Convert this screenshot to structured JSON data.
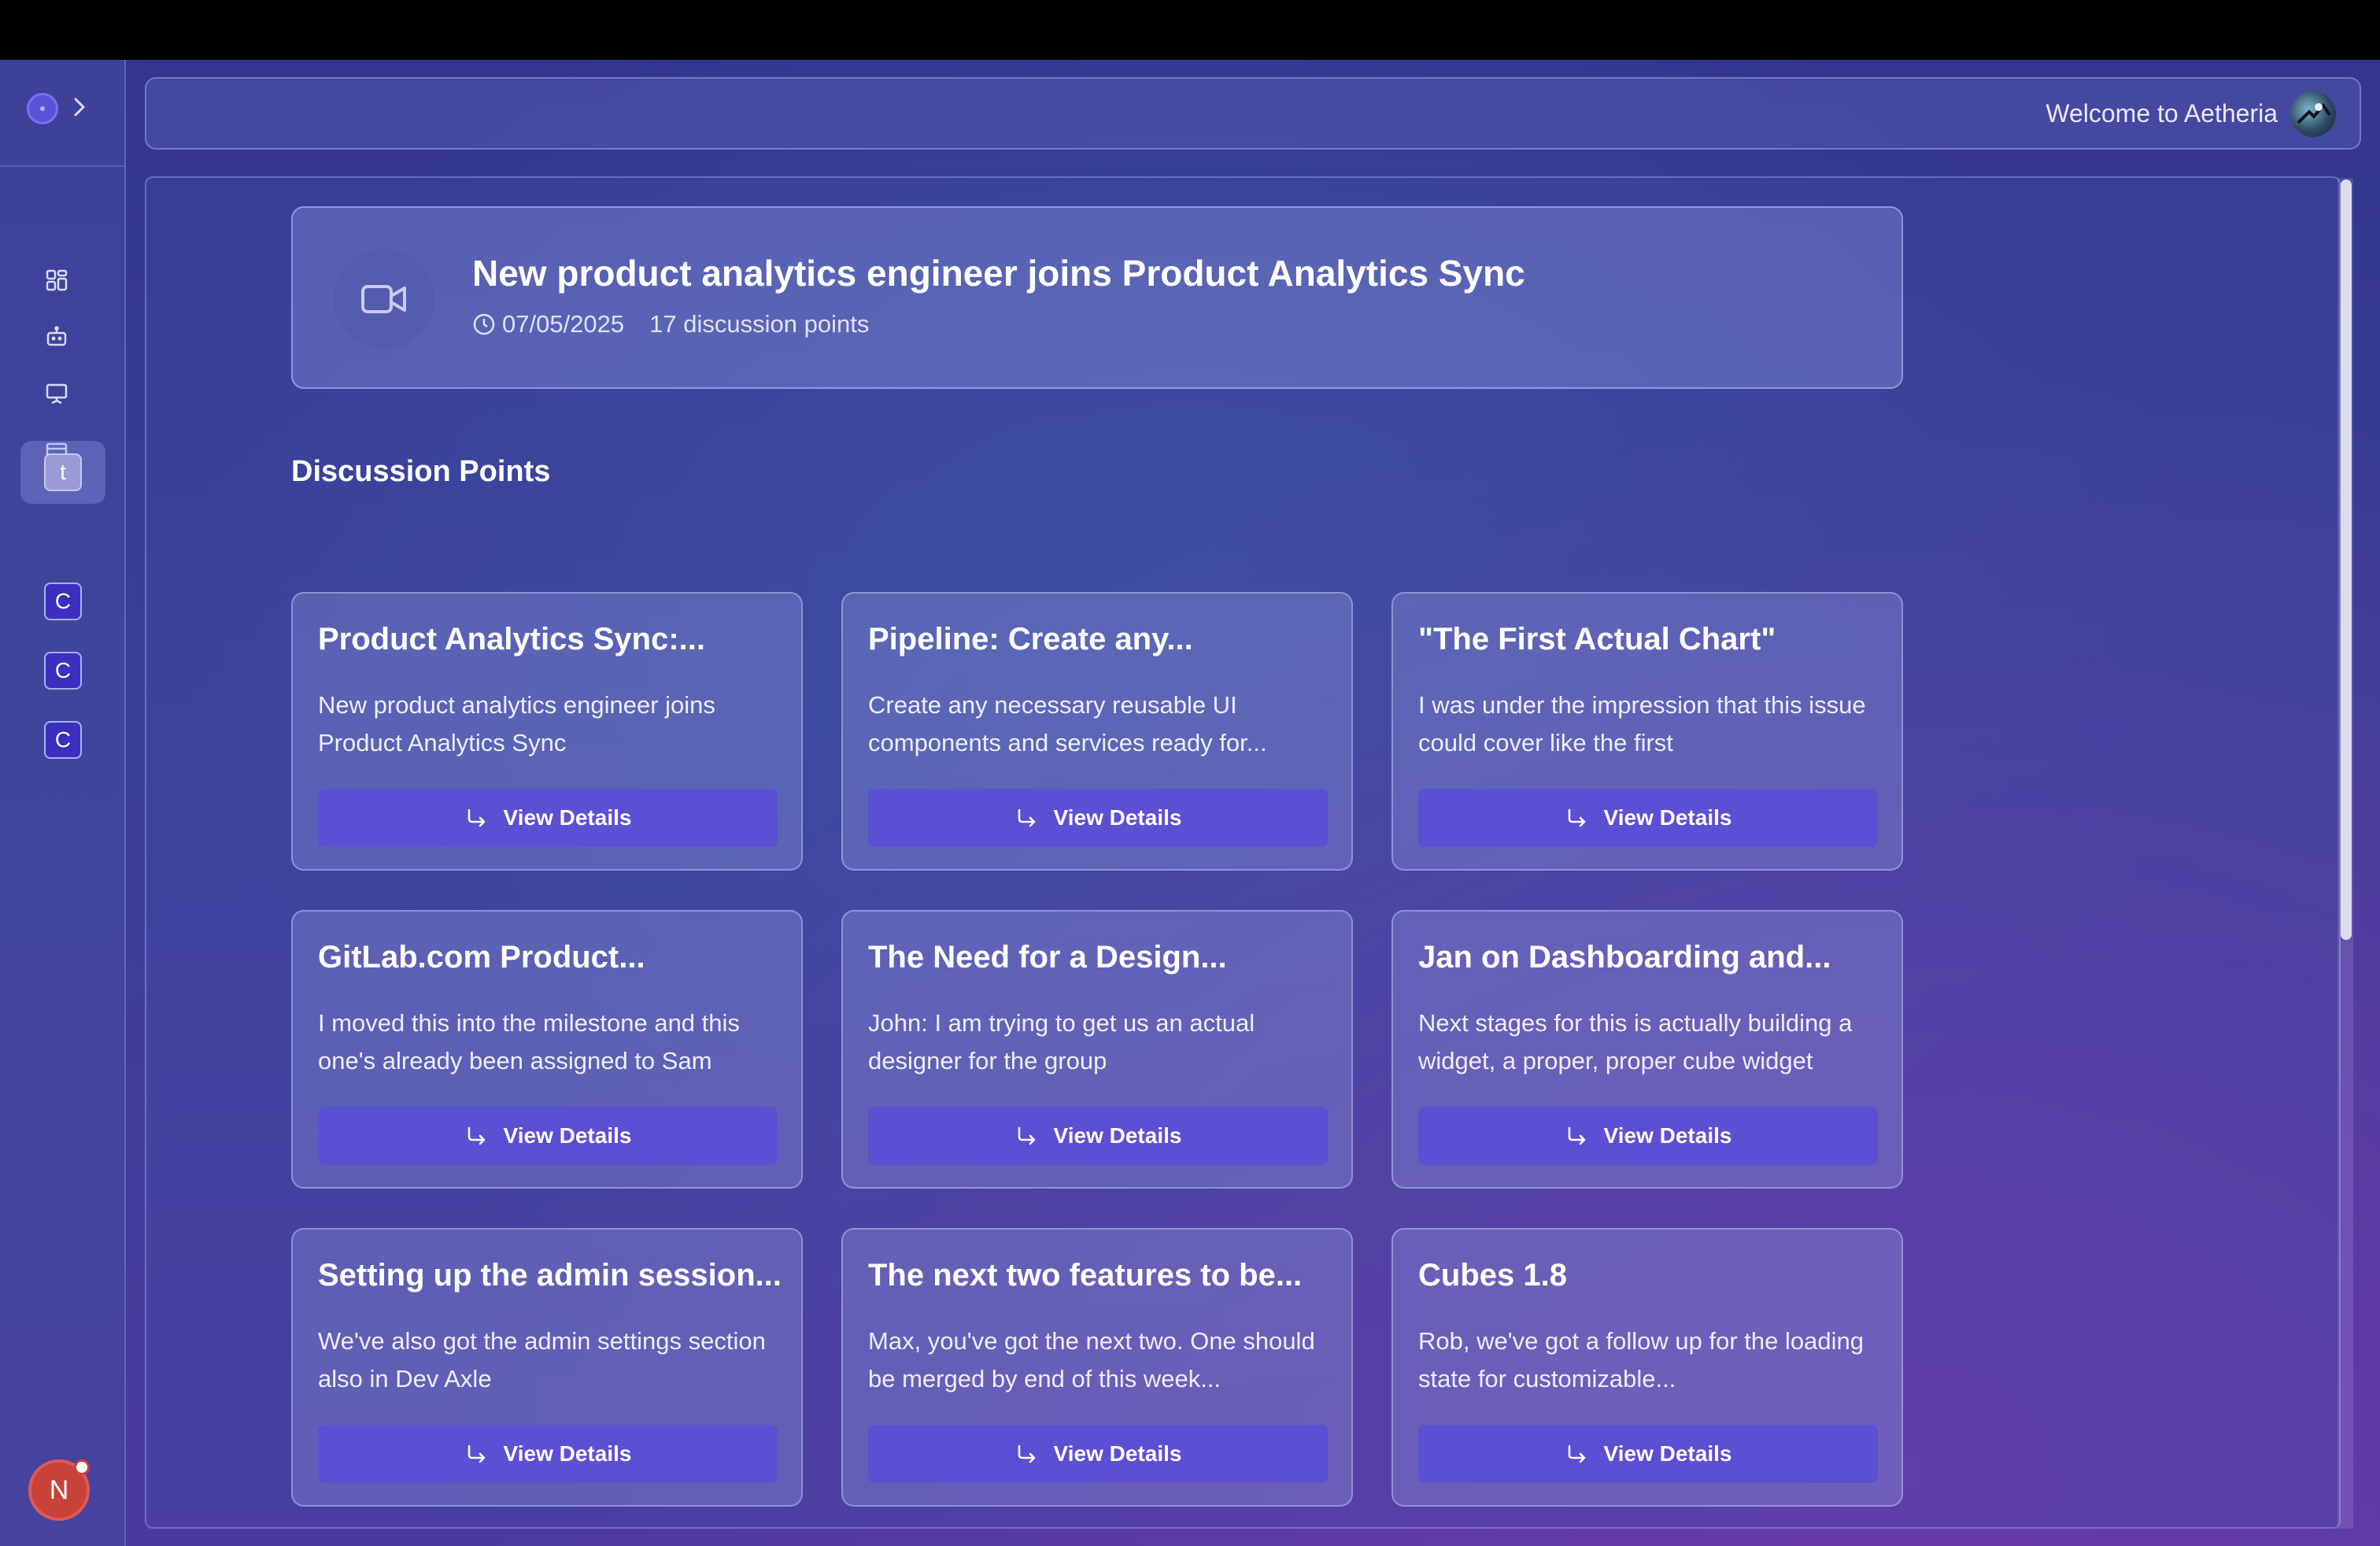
{
  "header": {
    "welcome_text": "Welcome to Aetheria"
  },
  "sidebar": {
    "nav_icons": [
      "dashboard-icon",
      "bot-icon",
      "presentation-icon",
      "card-icon"
    ],
    "workspaces": [
      {
        "letter": "t",
        "active": true
      },
      {
        "letter": "C",
        "active": false
      },
      {
        "letter": "C",
        "active": false
      },
      {
        "letter": "C",
        "active": false
      }
    ],
    "user_initial": "N"
  },
  "meeting": {
    "title": "New product analytics engineer joins Product Analytics Sync",
    "date": "07/05/2025",
    "points_count": "17 discussion points"
  },
  "section": {
    "title": "Discussion Points"
  },
  "cards": [
    {
      "title": "Product Analytics Sync:...",
      "description": "New product analytics engineer joins Product Analytics Sync",
      "button": "View Details"
    },
    {
      "title": "Pipeline: Create any...",
      "description": "Create any necessary reusable UI components and services ready for...",
      "button": "View Details"
    },
    {
      "title": "\"The First Actual Chart\"",
      "description": "I was under the impression that this issue could cover like the first",
      "button": "View Details"
    },
    {
      "title": "GitLab.com Product...",
      "description": "I moved this into the milestone and this one's already been assigned to Sam",
      "button": "View Details"
    },
    {
      "title": "The Need for a Design...",
      "description": "John: I am trying to get us an actual designer for the group",
      "button": "View Details"
    },
    {
      "title": "Jan on Dashboarding and...",
      "description": "Next stages for this is actually building a widget, a proper, proper cube widget",
      "button": "View Details"
    },
    {
      "title": "Setting up the admin session...",
      "description": "We've also got the admin settings section also in Dev Axle",
      "button": "View Details"
    },
    {
      "title": "The next two features to be...",
      "description": "Max, you've got the next two. One should be merged by end of this week...",
      "button": "View Details"
    },
    {
      "title": "Cubes 1.8",
      "description": "Rob, we've got a follow up for the loading state for customizable...",
      "button": "View Details"
    }
  ]
}
